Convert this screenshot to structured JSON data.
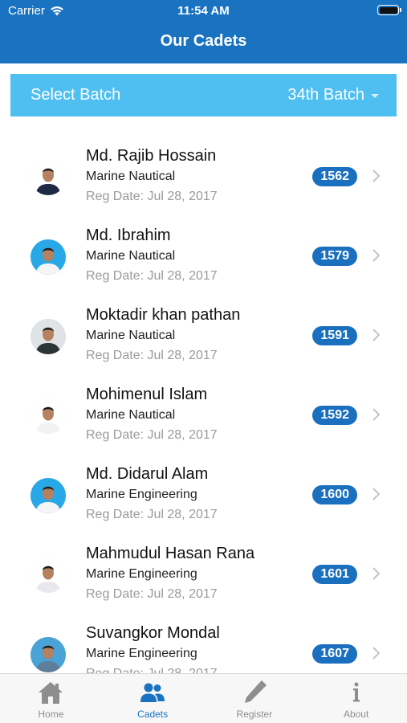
{
  "status_bar": {
    "carrier": "Carrier",
    "time": "11:54 AM"
  },
  "nav": {
    "title": "Our Cadets"
  },
  "batch": {
    "label": "Select Batch",
    "value": "34th Batch"
  },
  "cadets": [
    {
      "name": "Md. Rajib Hossain",
      "dept": "Marine Nautical",
      "reg": "Reg Date: Jul 28, 2017",
      "id": "1562"
    },
    {
      "name": "Md. Ibrahim",
      "dept": "Marine Nautical",
      "reg": "Reg Date: Jul 28, 2017",
      "id": "1579"
    },
    {
      "name": "Moktadir khan pathan",
      "dept": "Marine Nautical",
      "reg": "Reg Date: Jul 28, 2017",
      "id": "1591"
    },
    {
      "name": "Mohimenul Islam",
      "dept": "Marine Nautical",
      "reg": "Reg Date: Jul 28, 2017",
      "id": "1592"
    },
    {
      "name": "Md. Didarul Alam",
      "dept": "Marine Engineering",
      "reg": "Reg Date: Jul 28, 2017",
      "id": "1600"
    },
    {
      "name": "Mahmudul Hasan Rana",
      "dept": "Marine Engineering",
      "reg": "Reg Date: Jul 28, 2017",
      "id": "1601"
    },
    {
      "name": "Suvangkor Mondal",
      "dept": "Marine Engineering",
      "reg": "Reg Date: Jul 28, 2017",
      "id": "1607"
    }
  ],
  "tabs": [
    {
      "label": "Home",
      "icon": "home-icon"
    },
    {
      "label": "Cadets",
      "icon": "people-icon"
    },
    {
      "label": "Register",
      "icon": "pencil-icon"
    },
    {
      "label": "About",
      "icon": "info-icon"
    }
  ],
  "active_tab": "Cadets",
  "colors": {
    "header": "#1a73c0",
    "batch_bar": "#4fbef0",
    "badge": "#1a6fbe",
    "active_tab": "#1a73c0",
    "inactive_tab": "#8e8e8e"
  }
}
